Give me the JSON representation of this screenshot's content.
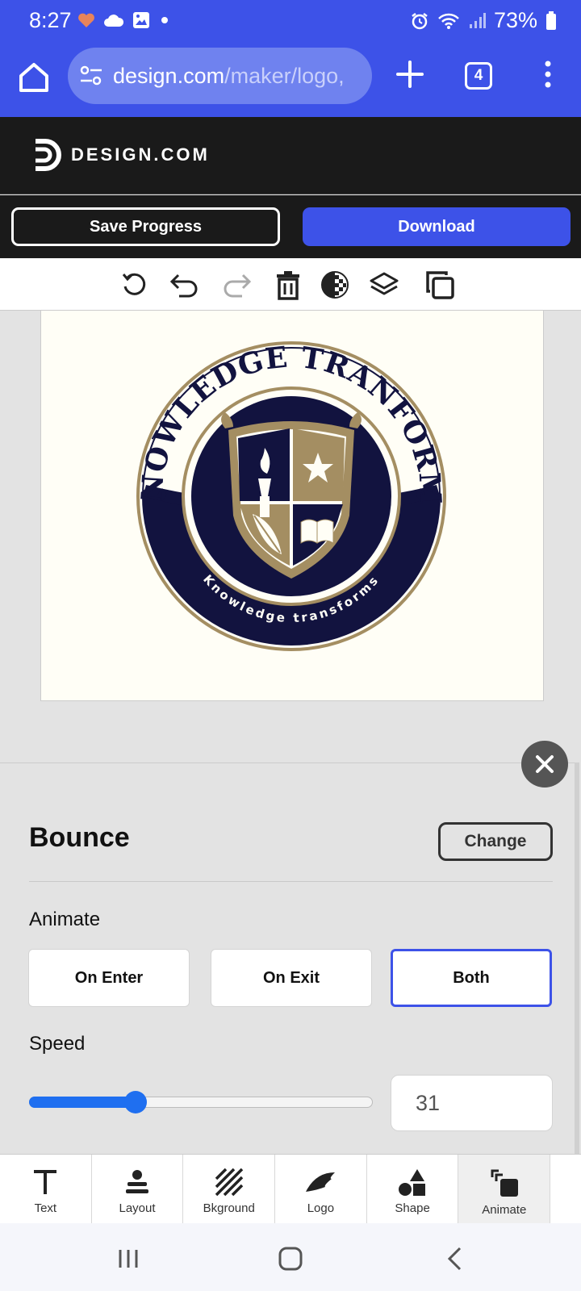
{
  "status_bar": {
    "time": "8:27",
    "battery": "73%",
    "left_icons": [
      "heart-icon",
      "cloud-icon",
      "image-icon",
      "dot-icon"
    ],
    "right_icons": [
      "alarm-icon",
      "wifi-icon",
      "signal-icon",
      "battery-icon"
    ]
  },
  "browser": {
    "url_host": "design.com",
    "url_path": "/maker/logo,",
    "tab_count": "4"
  },
  "site": {
    "brand": "DESIGN.COM"
  },
  "actions": {
    "save_label": "Save Progress",
    "download_label": "Download"
  },
  "toolbar": {
    "tools": [
      "reset-icon",
      "undo-icon",
      "redo-icon",
      "trash-icon",
      "transparency-icon",
      "layers-icon",
      "duplicate-icon"
    ]
  },
  "logo": {
    "top_text": "KNOWLEDGE TRANFORMS",
    "bottom_text": "Knowledge transforms",
    "colors": {
      "navy": "#12133f",
      "gold": "#a48e62",
      "cream": "#fffef6"
    }
  },
  "panel": {
    "title": "Bounce",
    "change_label": "Change",
    "animate_label": "Animate",
    "options": [
      "On Enter",
      "On Exit",
      "Both"
    ],
    "selected_option": "Both",
    "speed_label": "Speed",
    "speed_value": "31",
    "speed_fraction": 0.31
  },
  "bottom_nav": {
    "items": [
      "Text",
      "Layout",
      "Bkground",
      "Logo",
      "Shape",
      "Animate"
    ],
    "active": "Animate"
  },
  "colors": {
    "accent": "#3d52e8",
    "slider": "#1f6ff0"
  }
}
